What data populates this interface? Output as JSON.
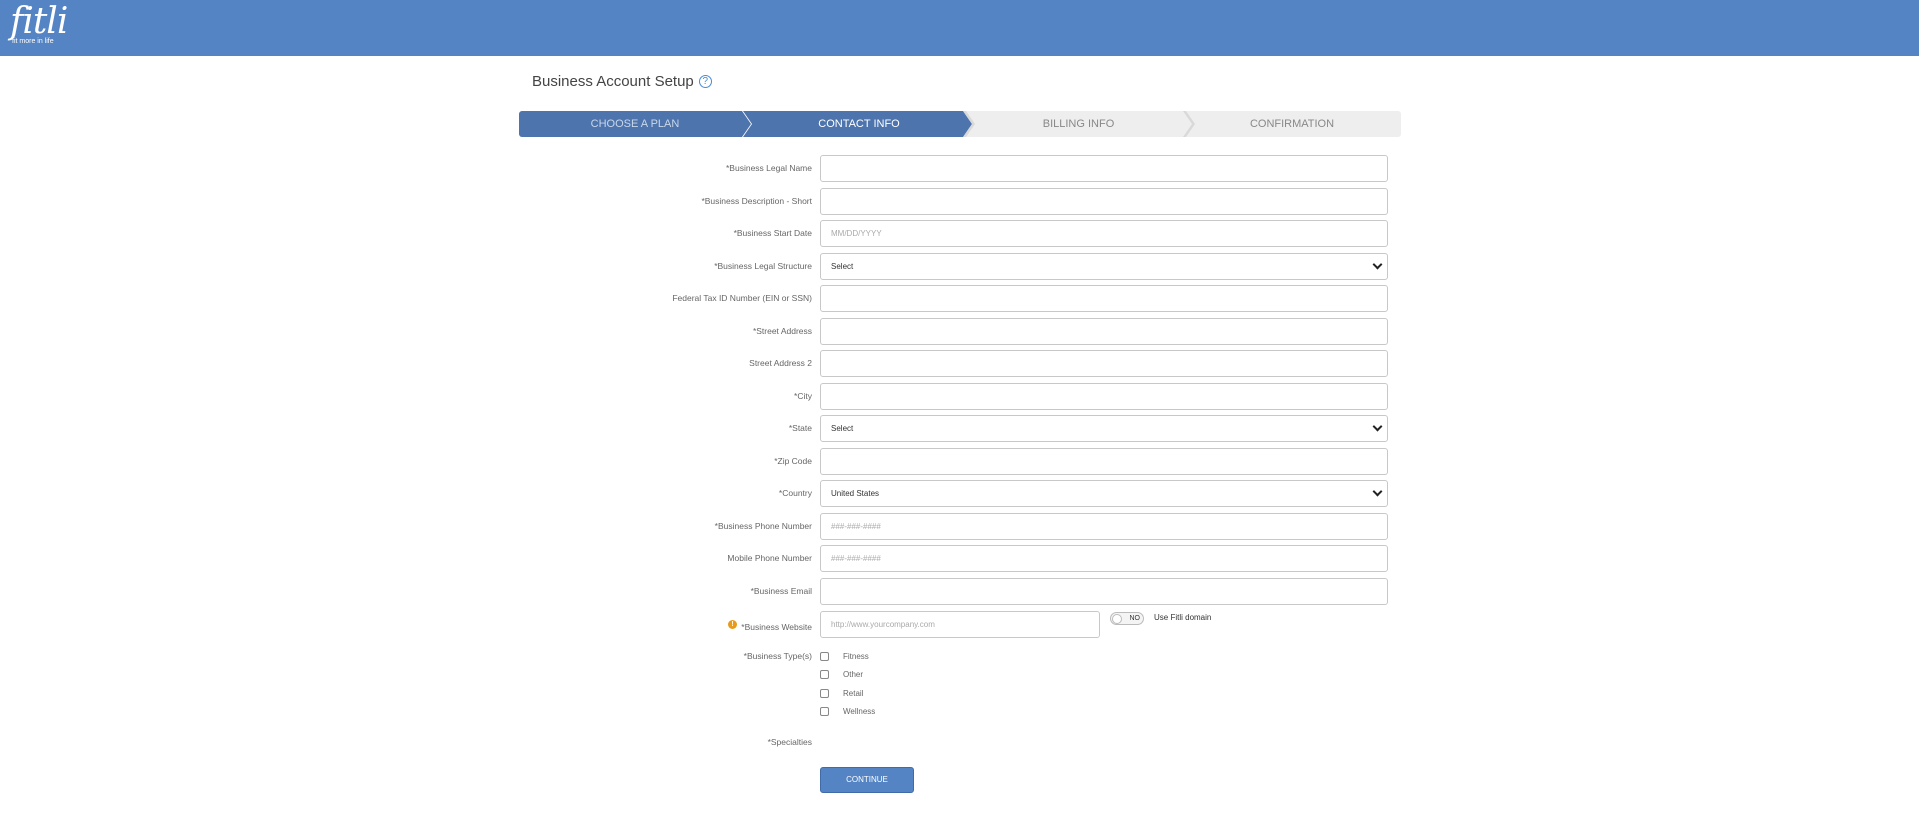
{
  "header": {
    "logo_word": "fitli",
    "logo_tagline": "fit more in life",
    "brand_color": "#5484c4"
  },
  "page": {
    "title": "Business Account Setup",
    "help_icon": "?"
  },
  "steps": [
    {
      "label": "CHOOSE A PLAN",
      "state": "completed"
    },
    {
      "label": "CONTACT INFO",
      "state": "active"
    },
    {
      "label": "BILLING INFO",
      "state": "upcoming"
    },
    {
      "label": "CONFIRMATION",
      "state": "upcoming"
    }
  ],
  "form": {
    "fields": [
      {
        "label": "*Business Legal Name",
        "value": "",
        "placeholder": ""
      },
      {
        "label": "*Business Description - Short",
        "value": "",
        "placeholder": ""
      },
      {
        "label": "*Business Start Date",
        "value": "",
        "placeholder": "MM/DD/YYYY"
      },
      {
        "label": "*Business Legal Structure",
        "value": "Select",
        "placeholder": ""
      },
      {
        "label": "Federal Tax ID Number (EIN or SSN)",
        "value": "",
        "placeholder": ""
      },
      {
        "label": "*Street Address",
        "value": "",
        "placeholder": ""
      },
      {
        "label": "Street Address 2",
        "value": "",
        "placeholder": ""
      },
      {
        "label": "*City",
        "value": "",
        "placeholder": ""
      },
      {
        "label": "*State",
        "value": "Select",
        "placeholder": ""
      },
      {
        "label": "*Zip Code",
        "value": "",
        "placeholder": ""
      },
      {
        "label": "*Country",
        "value": "United States",
        "placeholder": ""
      },
      {
        "label": "*Business Phone Number",
        "value": "",
        "placeholder": "###-###-####"
      },
      {
        "label": "Mobile Phone Number",
        "value": "",
        "placeholder": "###-###-####"
      },
      {
        "label": "*Business Email",
        "value": "",
        "placeholder": ""
      }
    ],
    "website": {
      "label": "*Business Website",
      "placeholder": "http://www.yourcompany.com",
      "toggle_text": "NO",
      "toggle_label": "Use Fitli domain",
      "warning_icon": "!"
    },
    "business_types": {
      "label": "*Business Type(s)",
      "options": [
        "Fitness",
        "Other",
        "Retail",
        "Wellness"
      ]
    },
    "specialties_label": "*Specialties",
    "continue_label": "CONTINUE"
  }
}
